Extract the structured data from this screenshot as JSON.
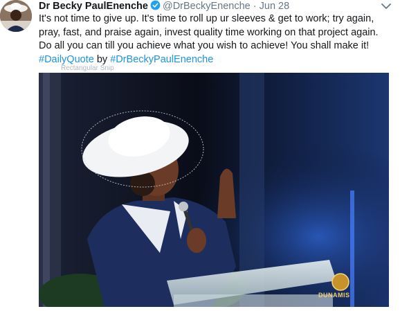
{
  "tweet": {
    "author_name": "Dr Becky PaulEnenche",
    "handle": "@DrBeckyEnenche",
    "separator": "·",
    "date": "Jun 28",
    "text_main": "It's not time to give up. It's time to roll up ur sleeves & get to work; try again, pray, fast, and praise again, invest quality time working on that project again. Do all you can till you achieve what you wish to achieve! You shall make it!",
    "hashtag_1": "#DailyQuote",
    "by_word": "by",
    "hashtag_2": "#DrBeckyPaulEnenche"
  },
  "overlay": {
    "snip_label": "Rectangular Snip"
  },
  "photo": {
    "watermark": "DUNAMIS"
  },
  "colors": {
    "hashtag": "#1b95e0",
    "secondary_text": "#657786",
    "verified_badge": "#1da1f2"
  }
}
